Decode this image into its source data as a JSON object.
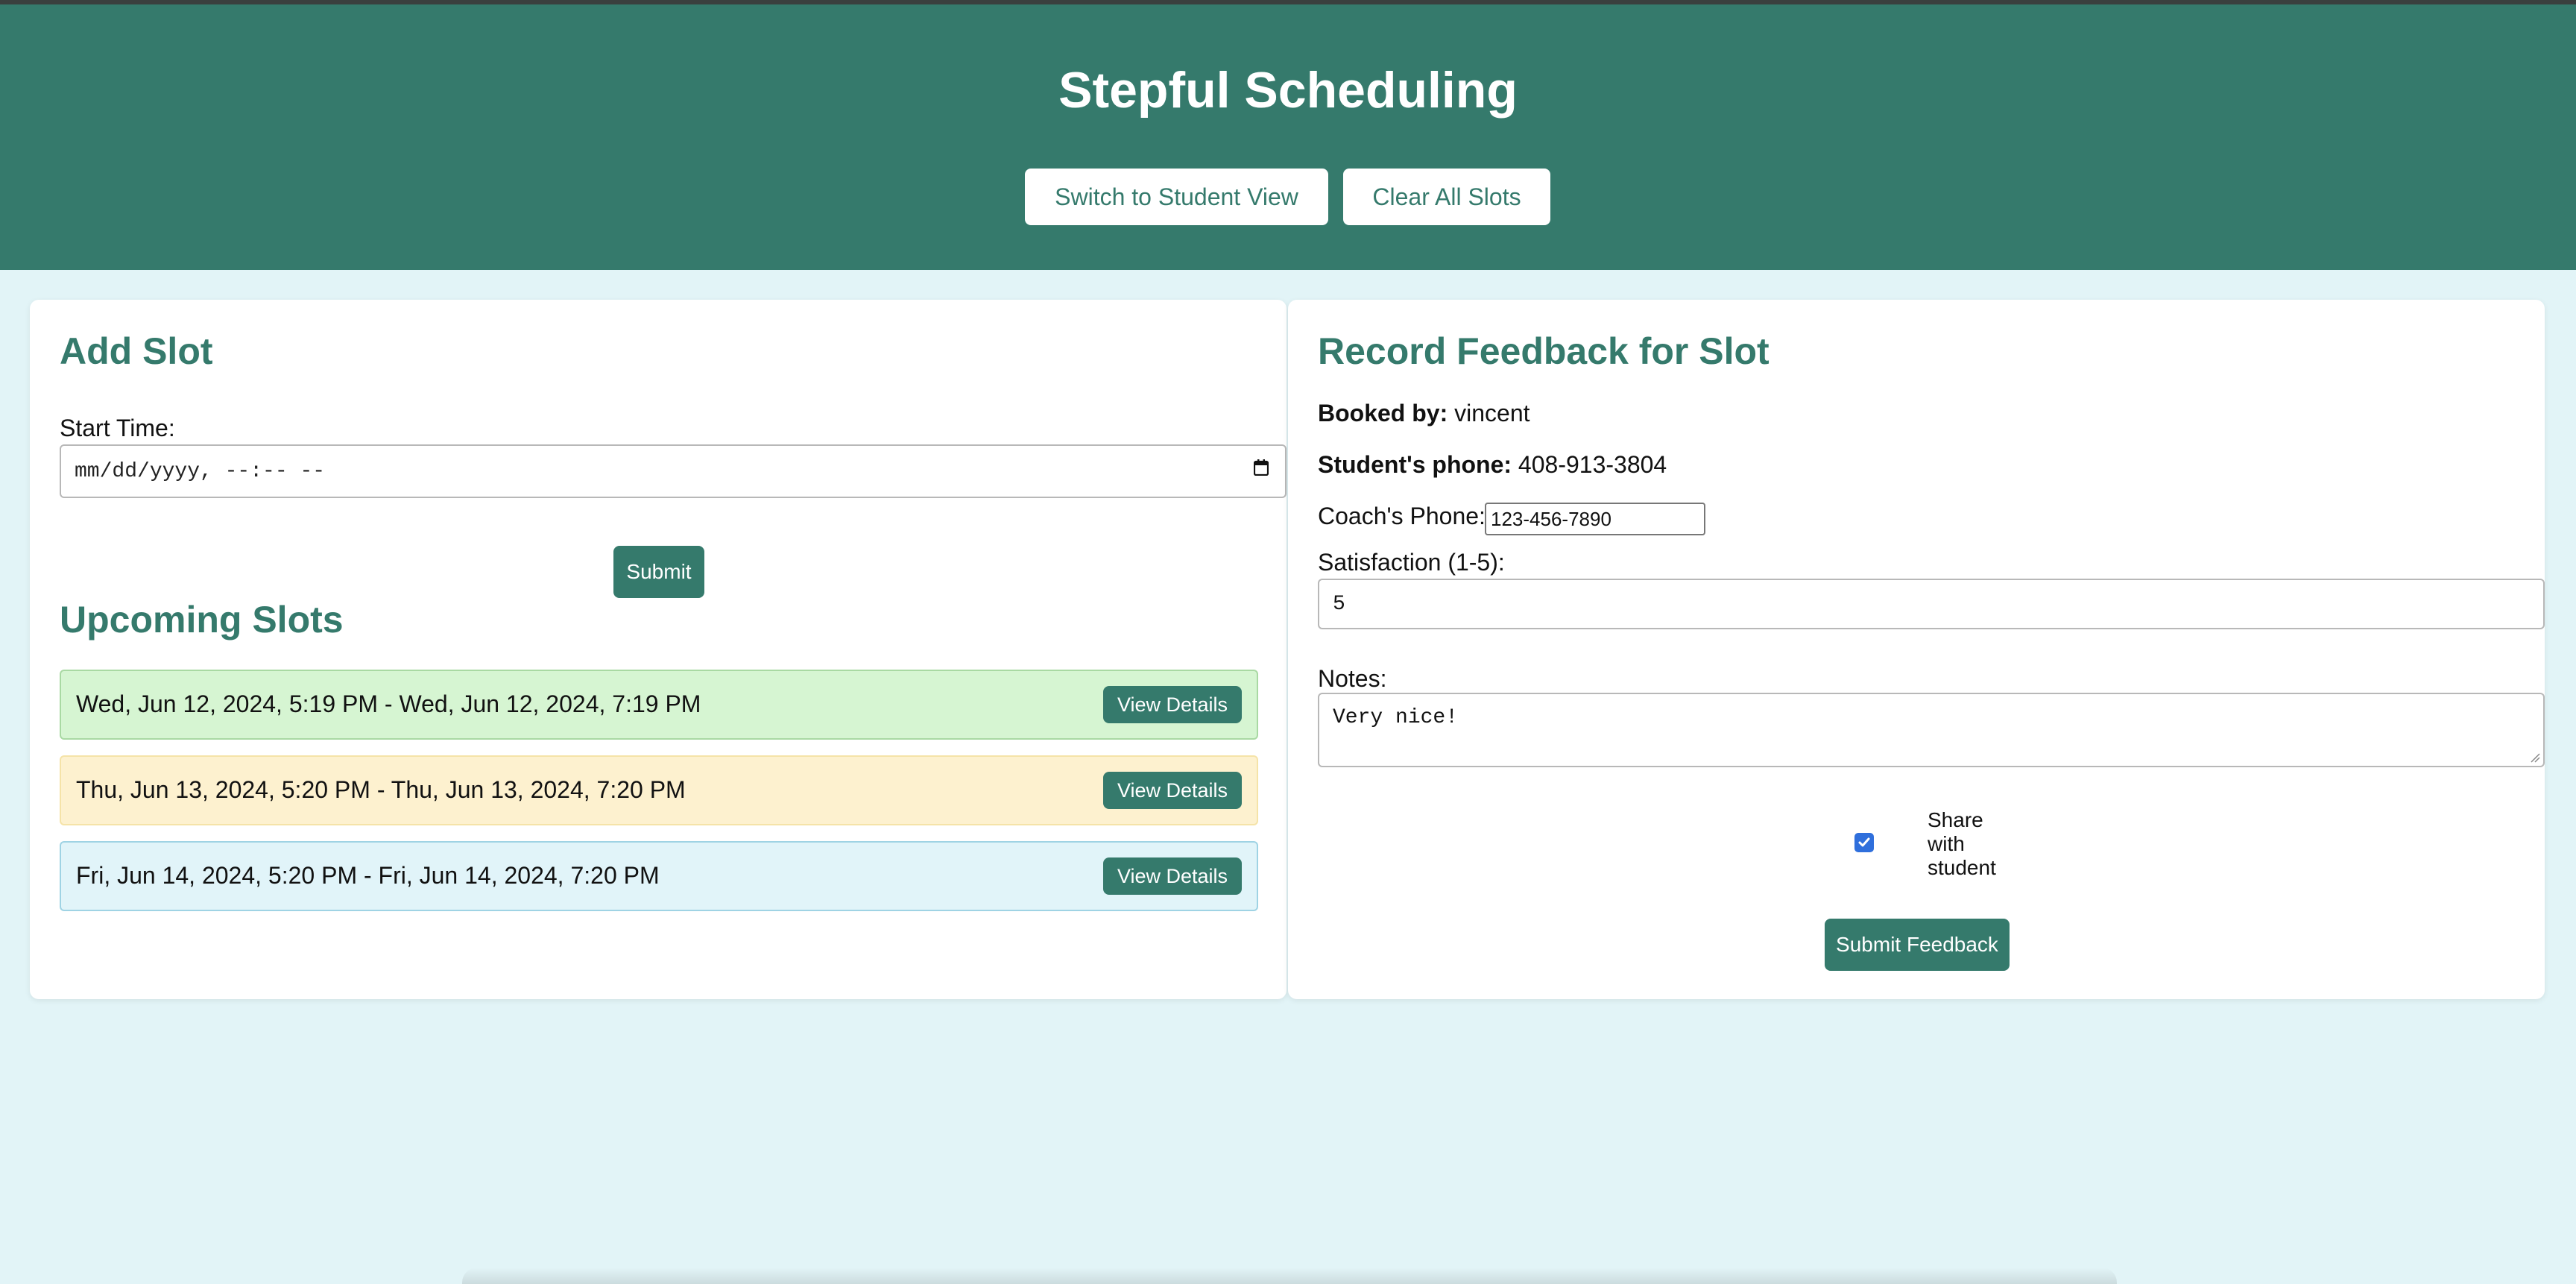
{
  "header": {
    "title": "Stepful Scheduling",
    "switch_button": "Switch to Student View",
    "clear_button": "Clear All Slots"
  },
  "add_slot": {
    "heading": "Add Slot",
    "start_time_label": "Start Time:",
    "start_time_placeholder": "mm/dd/yyyy, --:-- --",
    "submit_button": "Submit"
  },
  "upcoming": {
    "heading": "Upcoming Slots",
    "view_button": "View Details",
    "slots": [
      {
        "text": "Wed, Jun 12, 2024, 5:19 PM - Wed, Jun 12, 2024, 7:19 PM",
        "bg": "#d6f5d2",
        "border": "#a9d9a3"
      },
      {
        "text": "Thu, Jun 13, 2024, 5:20 PM - Thu, Jun 13, 2024, 7:20 PM",
        "bg": "#fdf1cf",
        "border": "#f5e3a8"
      },
      {
        "text": "Fri, Jun 14, 2024, 5:20 PM - Fri, Jun 14, 2024, 7:20 PM",
        "bg": "#e1f4f9",
        "border": "#9fd3e4"
      }
    ]
  },
  "feedback": {
    "heading": "Record Feedback for Slot",
    "booked_by_label": "Booked by:",
    "booked_by_value": "vincent",
    "student_phone_label": "Student's phone:",
    "student_phone_value": "408-913-3804",
    "coach_phone_label": "Coach's Phone:",
    "coach_phone_value": "123-456-7890",
    "satisfaction_label": "Satisfaction (1-5):",
    "satisfaction_value": "5",
    "notes_label": "Notes:",
    "notes_value": "Very nice!",
    "share_label": "Share with student",
    "share_checked": true,
    "submit_button": "Submit Feedback"
  },
  "colors": {
    "brand": "#357a6c",
    "page_bg": "#e2f4f7",
    "checkbox": "#2f6fdc"
  }
}
